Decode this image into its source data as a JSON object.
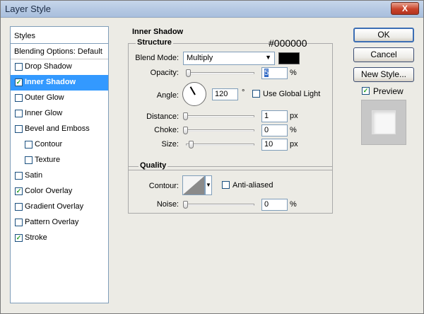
{
  "window": {
    "title": "Layer Style",
    "close_label": "X"
  },
  "styles_panel": {
    "header": "Styles",
    "blending_options": "Blending Options: Default",
    "items": [
      {
        "label": "Drop Shadow",
        "checked": false,
        "selected": false,
        "sub": false
      },
      {
        "label": "Inner Shadow",
        "checked": true,
        "selected": true,
        "sub": false
      },
      {
        "label": "Outer Glow",
        "checked": false,
        "selected": false,
        "sub": false
      },
      {
        "label": "Inner Glow",
        "checked": false,
        "selected": false,
        "sub": false
      },
      {
        "label": "Bevel and Emboss",
        "checked": false,
        "selected": false,
        "sub": false
      },
      {
        "label": "Contour",
        "checked": false,
        "selected": false,
        "sub": true
      },
      {
        "label": "Texture",
        "checked": false,
        "selected": false,
        "sub": true
      },
      {
        "label": "Satin",
        "checked": false,
        "selected": false,
        "sub": false
      },
      {
        "label": "Color Overlay",
        "checked": true,
        "selected": false,
        "sub": false
      },
      {
        "label": "Gradient Overlay",
        "checked": false,
        "selected": false,
        "sub": false
      },
      {
        "label": "Pattern Overlay",
        "checked": false,
        "selected": false,
        "sub": false
      },
      {
        "label": "Stroke",
        "checked": true,
        "selected": false,
        "sub": false
      }
    ]
  },
  "inner_shadow": {
    "title": "Inner Shadow",
    "color_hex": "#000000",
    "structure": {
      "title": "Structure",
      "blend_mode_label": "Blend Mode:",
      "blend_mode_value": "Multiply",
      "shadow_color": "#000000",
      "opacity_label": "Opacity:",
      "opacity_value": "5",
      "opacity_unit": "%",
      "angle_label": "Angle:",
      "angle_value": "120",
      "angle_unit": "°",
      "global_light_label": "Use Global Light",
      "global_light_checked": false,
      "distance_label": "Distance:",
      "distance_value": "1",
      "distance_unit": "px",
      "choke_label": "Choke:",
      "choke_value": "0",
      "choke_unit": "%",
      "size_label": "Size:",
      "size_value": "10",
      "size_unit": "px"
    },
    "quality": {
      "title": "Quality",
      "contour_label": "Contour:",
      "anti_aliased_label": "Anti-aliased",
      "anti_aliased_checked": false,
      "noise_label": "Noise:",
      "noise_value": "0",
      "noise_unit": "%"
    }
  },
  "buttons": {
    "ok": "OK",
    "cancel": "Cancel",
    "new_style": "New Style...",
    "preview_label": "Preview",
    "preview_checked": true
  }
}
